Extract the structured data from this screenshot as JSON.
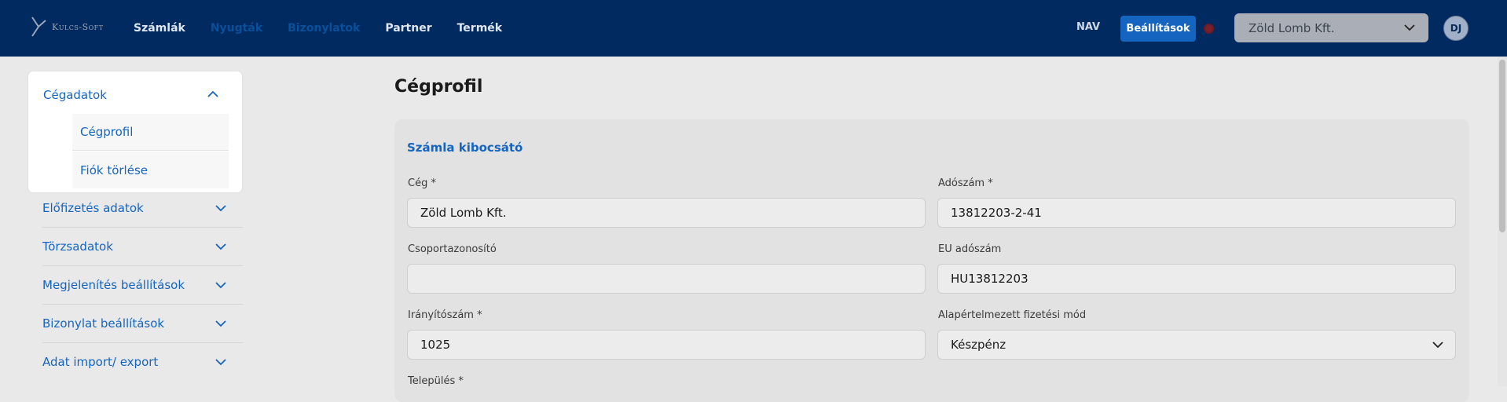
{
  "brand": {
    "logo_text": "Kulcs-Soft"
  },
  "nav": {
    "items": [
      {
        "label": "Számlák",
        "dim": false
      },
      {
        "label": "Nyugták",
        "dim": true
      },
      {
        "label": "Bizonylatok",
        "dim": true
      },
      {
        "label": "Partner",
        "dim": false
      },
      {
        "label": "Termék",
        "dim": false
      }
    ],
    "nav_link": "NAV",
    "settings_label": "Beállítások",
    "company": "Zöld Lomb Kft.",
    "avatar_initials": "DJ"
  },
  "sidebar": {
    "open_group": {
      "label": "Cégadatok",
      "items": [
        "Cégprofil",
        "Fiók törlése"
      ]
    },
    "groups": [
      "Előfizetés adatok",
      "Törzsadatok",
      "Megjelenítés beállítások",
      "Bizonylat beállítások",
      "Adat import/ export"
    ]
  },
  "main": {
    "title": "Cégprofil",
    "section": "Számla kibocsátó",
    "fields": {
      "company": {
        "label": "Cég *",
        "value": "Zöld Lomb Kft."
      },
      "tax_number": {
        "label": "Adószám *",
        "value": "13812203-2-41"
      },
      "group_id": {
        "label": "Csoportazonosító",
        "value": ""
      },
      "eu_tax": {
        "label": "EU adószám",
        "value": "HU13812203"
      },
      "zip": {
        "label": "Irányítószám *",
        "value": "1025"
      },
      "payment": {
        "label": "Alapértelmezett fizetési mód",
        "value": "Készpénz"
      },
      "city": {
        "label": "Település *"
      }
    }
  },
  "colors": {
    "topbar": "#002a60",
    "accent": "#1565c0"
  }
}
